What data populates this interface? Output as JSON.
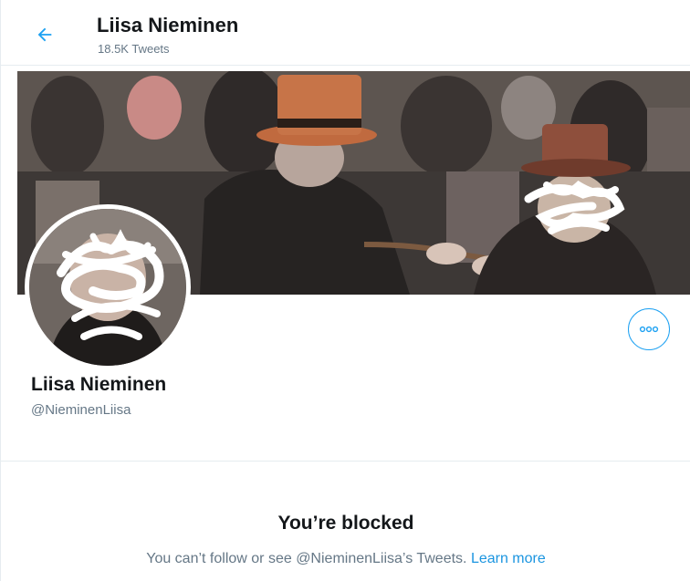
{
  "header": {
    "title": "Liisa Nieminen",
    "tweet_count": "18.5K Tweets",
    "back_icon": "arrow-left-icon"
  },
  "profile": {
    "display_name": "Liisa Nieminen",
    "handle": "@NieminenLiisa",
    "more_icon": "more-options-icon"
  },
  "blocked": {
    "title": "You’re blocked",
    "message": "You can’t follow or see @NieminenLiisa’s Tweets.",
    "learn_more": "Learn more"
  },
  "colors": {
    "accent": "#1da1f2",
    "link": "#1b95e0",
    "secondary_text": "#657786",
    "border": "#e6ecf0"
  }
}
